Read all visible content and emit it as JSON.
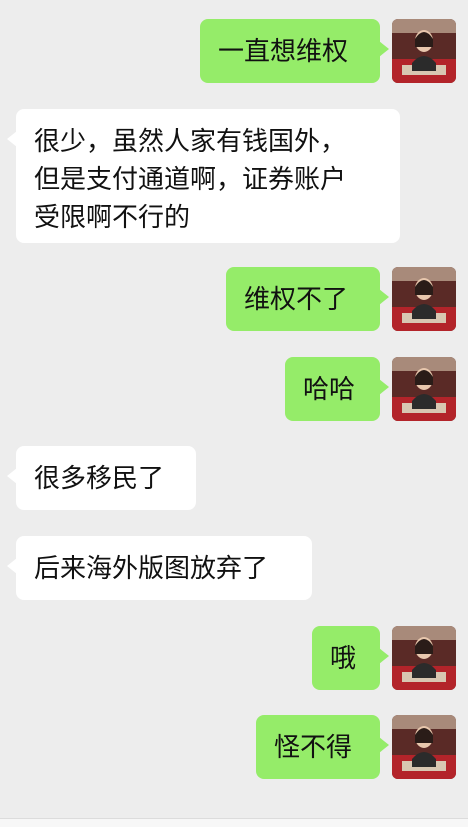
{
  "messages": [
    {
      "side": "out",
      "text": "一直想维权"
    },
    {
      "side": "in",
      "text": "很少，虽然人家有钱国外，\n但是支付通道啊，证券账户\n受限啊不行的"
    },
    {
      "side": "out",
      "text": "维权不了"
    },
    {
      "side": "out",
      "text": "哈哈"
    },
    {
      "side": "in",
      "text": "很多移民了"
    },
    {
      "side": "in",
      "text": "后来海外版图放弃了"
    },
    {
      "side": "out",
      "text": "哦"
    },
    {
      "side": "out",
      "text": "怪不得"
    }
  ],
  "colors": {
    "background": "#ededed",
    "outgoing_bubble": "#95ec69",
    "incoming_bubble": "#ffffff"
  },
  "icons": {
    "avatar": "user-photo-avatar"
  }
}
